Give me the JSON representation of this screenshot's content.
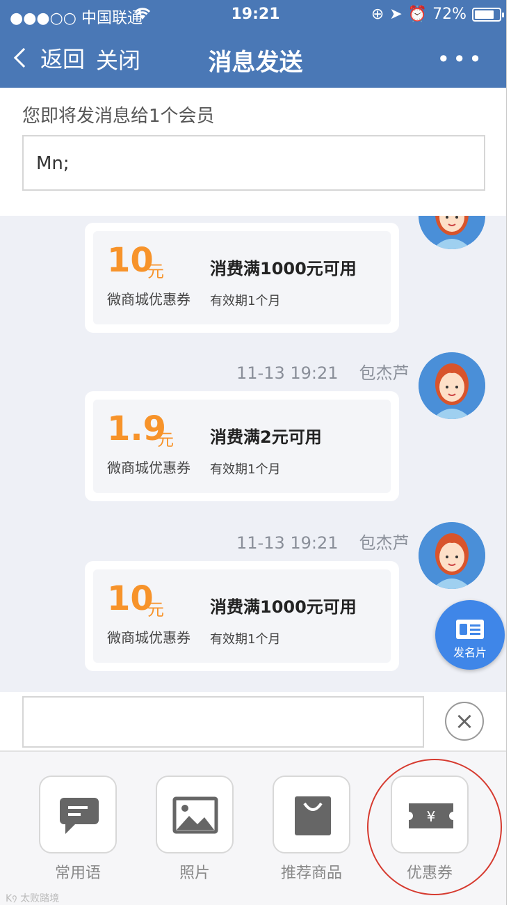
{
  "status_bar": {
    "carrier": "●●●○○ 中国联通",
    "wifi_icon": "wifi-icon",
    "time": "19:21",
    "battery_percent": "72%"
  },
  "nav": {
    "back_label": "返回",
    "close_label": "关闭",
    "title": "消息发送",
    "more_label": "•••"
  },
  "recipient": {
    "hint": "您即将发消息给1个会员",
    "value": "Mn;"
  },
  "messages": [
    {
      "time": "",
      "sender": "",
      "amount": "10",
      "unit": "元",
      "condition": "消费满1000元可用",
      "shop": "微商城优惠券",
      "validity": "有效期1个月"
    },
    {
      "time": "11-13 19:21",
      "sender": "包杰芦",
      "amount": "1.9",
      "unit": "元",
      "condition": "消费满2元可用",
      "shop": "微商城优惠券",
      "validity": "有效期1个月"
    },
    {
      "time": "11-13 19:21",
      "sender": "包杰芦",
      "amount": "10",
      "unit": "元",
      "condition": "消费满1000元可用",
      "shop": "微商城优惠券",
      "validity": "有效期1个月"
    }
  ],
  "fab": {
    "label": "发名片",
    "icon": "business-card-icon"
  },
  "input": {
    "placeholder": "",
    "clear_icon": "close-icon"
  },
  "tools": [
    {
      "label": "常用语",
      "icon": "chat-bubble-icon"
    },
    {
      "label": "照片",
      "icon": "image-icon"
    },
    {
      "label": "推荐商品",
      "icon": "shopping-bag-icon"
    },
    {
      "label": "优惠券",
      "icon": "coupon-icon"
    }
  ],
  "watermark": "K᠀ 太败踏境",
  "colors": {
    "nav_bg": "#4a78b6",
    "accent_orange": "#f7932a",
    "fab_blue": "#3f86e8",
    "highlight_red": "#d63a2f"
  }
}
